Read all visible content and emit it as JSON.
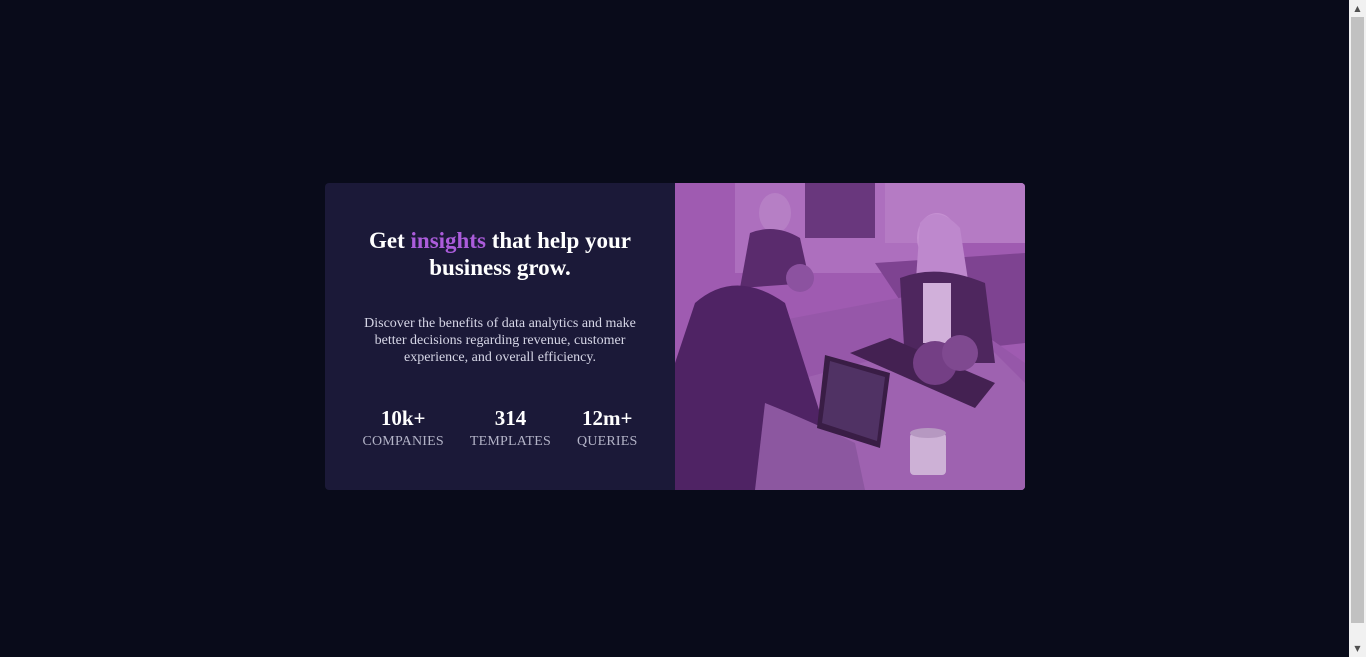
{
  "card": {
    "headline": {
      "before": "Get ",
      "accent": "insights",
      "after": " that help your business grow."
    },
    "description": "Discover the benefits of data analytics and make better decisions regarding revenue, customer experience, and overall efficiency.",
    "stats": [
      {
        "value": "10k+",
        "label": "COMPANIES"
      },
      {
        "value": "314",
        "label": "TEMPLATES"
      },
      {
        "value": "12m+",
        "label": "QUERIES"
      }
    ],
    "image": {
      "icon": "office-team-photo"
    }
  },
  "colors": {
    "background": "#090b1a",
    "card": "#1b1938",
    "accent": "#ab5cdb",
    "image_tint": "#8d4f9e"
  }
}
